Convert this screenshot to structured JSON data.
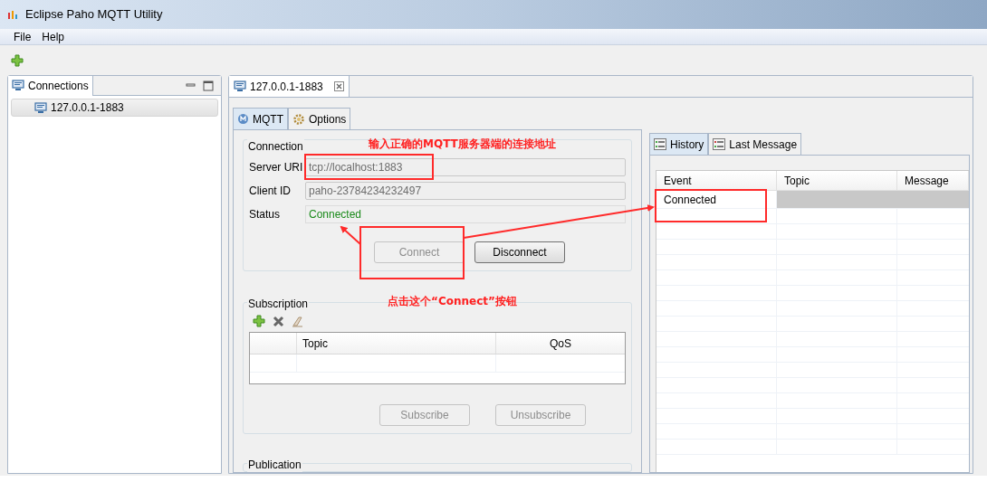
{
  "window": {
    "title": "Eclipse Paho MQTT Utility"
  },
  "menu": [
    "File",
    "Help"
  ],
  "connections_view": {
    "tab": "Connections",
    "items": [
      {
        "label": "127.0.0.1-1883",
        "selected": true
      }
    ]
  },
  "editor_tab": {
    "label": "127.0.0.1-1883"
  },
  "sub_tabs": [
    {
      "label": "MQTT",
      "selected": true
    },
    {
      "label": "Options",
      "selected": false
    }
  ],
  "connection": {
    "title": "Connection",
    "fields": [
      {
        "label": "Server URI",
        "value": "tcp://localhost:1883"
      },
      {
        "label": "Client ID",
        "value": "paho-23784234232497"
      }
    ],
    "status": {
      "label": "Status",
      "value": "Connected"
    },
    "buttons": [
      {
        "label": "Connect",
        "disabled": true
      },
      {
        "label": "Disconnect",
        "disabled": false
      }
    ]
  },
  "subscription": {
    "title": "Subscription",
    "columns": [
      "Topic",
      "QoS"
    ],
    "buttons": [
      {
        "label": "Subscribe",
        "disabled": true
      },
      {
        "label": "Unsubscribe",
        "disabled": true
      }
    ]
  },
  "publication": {
    "title": "Publication"
  },
  "history_tabs": [
    {
      "label": "History",
      "selected": true
    },
    {
      "label": "Last Message",
      "selected": false
    }
  ],
  "history": {
    "columns": [
      "Event",
      "Topic",
      "Message"
    ],
    "rows": [
      {
        "event": "Connected",
        "selected": true
      }
    ]
  },
  "annotations": [
    "输入正确的MQTT服务器端的连接地址",
    "点击这个“Connect”按钮"
  ]
}
